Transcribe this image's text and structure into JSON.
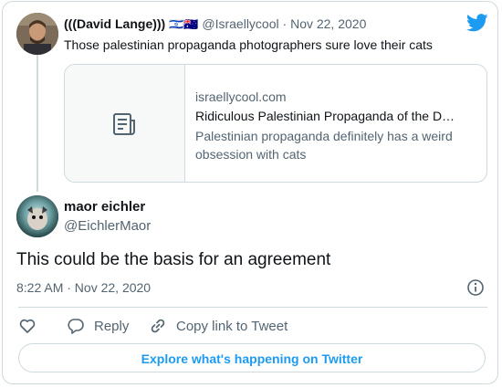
{
  "quoted_tweet": {
    "author_name": "(((David Lange)))",
    "flags": "🇮🇱🇦🇺",
    "handle": "@Israellycool",
    "separator": "·",
    "date": "Nov 22, 2020",
    "text": "Those palestinian propaganda photographers sure love their cats",
    "link_card": {
      "domain": "israellycool.com",
      "title": "Ridiculous Palestinian Propaganda of the D…",
      "description": "Palestinian propaganda definitely has a weird obsession with cats",
      "icon": "article-icon"
    }
  },
  "reply_tweet": {
    "author_name": "maor eichler",
    "handle": "@EichlerMaor",
    "text": "This could be the basis for an agreement",
    "timestamp": "8:22 AM · Nov 22, 2020"
  },
  "actions": {
    "like_icon": "heart-icon",
    "reply_label": "Reply",
    "copy_label": "Copy link to Tweet"
  },
  "explore_label": "Explore what's happening on Twitter",
  "colors": {
    "accent": "#1d9bf0",
    "muted_text": "#536471",
    "border": "#cfd9de"
  }
}
